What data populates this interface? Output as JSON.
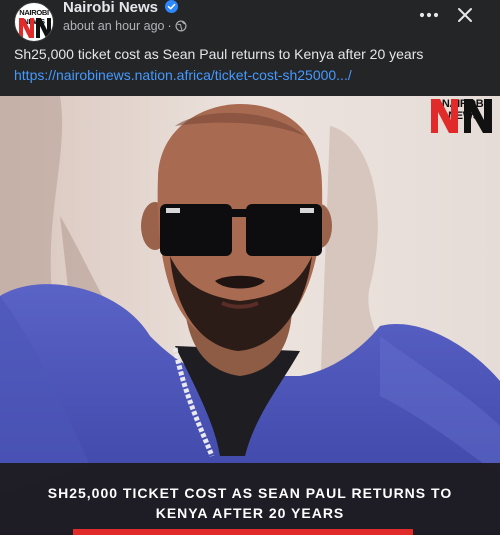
{
  "post": {
    "page_name": "Nairobi News",
    "timestamp": "about an hour ago",
    "separator": "·",
    "caption": "Sh25,000 ticket cost as Sean Paul returns to Kenya after 20 years",
    "link": "https://nairobinews.nation.africa/ticket-cost-sh25000.../"
  },
  "avatar": {
    "wordmark": "NAIROBI NEWS",
    "monogram": "NN"
  },
  "image": {
    "brand_wordmark": "NAIROBI NEWS",
    "brand_monogram": "NN",
    "headline": "SH25,000 TICKET COST AS SEAN PAUL RETURNS TO KENYA AFTER 20 YEARS"
  },
  "icons": {
    "verified": "verified-badge-icon",
    "audience": "globe-icon",
    "more": "more-dots-icon",
    "close": "close-icon"
  },
  "colors": {
    "background": "#242526",
    "text_primary": "#e4e6eb",
    "text_secondary": "#b0b3b8",
    "link": "#4599ff",
    "verified": "#2d88ff",
    "brand_red": "#e12b2b"
  }
}
